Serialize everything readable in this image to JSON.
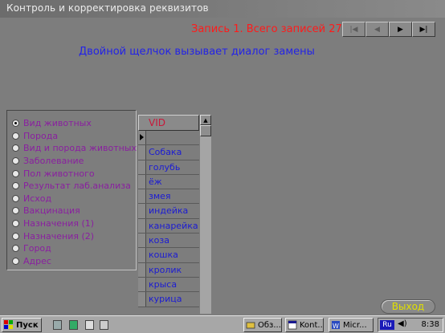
{
  "window": {
    "title": "Контроль и корректировка реквизитов"
  },
  "record_info": "Запись 1.  Всего записей 27",
  "nav": [
    {
      "name": "first-record-button",
      "glyph": "|◀",
      "enabled": false
    },
    {
      "name": "prev-record-button",
      "glyph": "◀",
      "enabled": false
    },
    {
      "name": "next-record-button",
      "glyph": "▶",
      "enabled": true
    },
    {
      "name": "last-record-button",
      "glyph": "▶|",
      "enabled": true
    }
  ],
  "hint": "Двойной щелчок вызывает диалог замены",
  "radio_options": [
    {
      "label": "Вид животных",
      "checked": true
    },
    {
      "label": "Порода",
      "checked": false
    },
    {
      "label": "Вид и порода животных",
      "checked": false
    },
    {
      "label": "Заболевание",
      "checked": false
    },
    {
      "label": "Пол животного",
      "checked": false
    },
    {
      "label": "Результат лаб.анализа",
      "checked": false
    },
    {
      "label": "Исход",
      "checked": false
    },
    {
      "label": "Вакцинация",
      "checked": false
    },
    {
      "label": "Назначения (1)",
      "checked": false
    },
    {
      "label": "Назначения (2)",
      "checked": false
    },
    {
      "label": "Город",
      "checked": false
    },
    {
      "label": "Адрес",
      "checked": false
    }
  ],
  "grid": {
    "column": "VID",
    "rows": [
      "",
      "Собака",
      "голубь",
      "ёж",
      "змея",
      "индейка",
      "канарейка",
      "коза",
      "кошка",
      "кролик",
      "крыса",
      "курица"
    ]
  },
  "exit_label": "Выход",
  "taskbar": {
    "start": "Пуск",
    "tasks": [
      "Обз...",
      "Kont...",
      "Micr..."
    ],
    "lang": "Ru",
    "clock": "8:38"
  }
}
